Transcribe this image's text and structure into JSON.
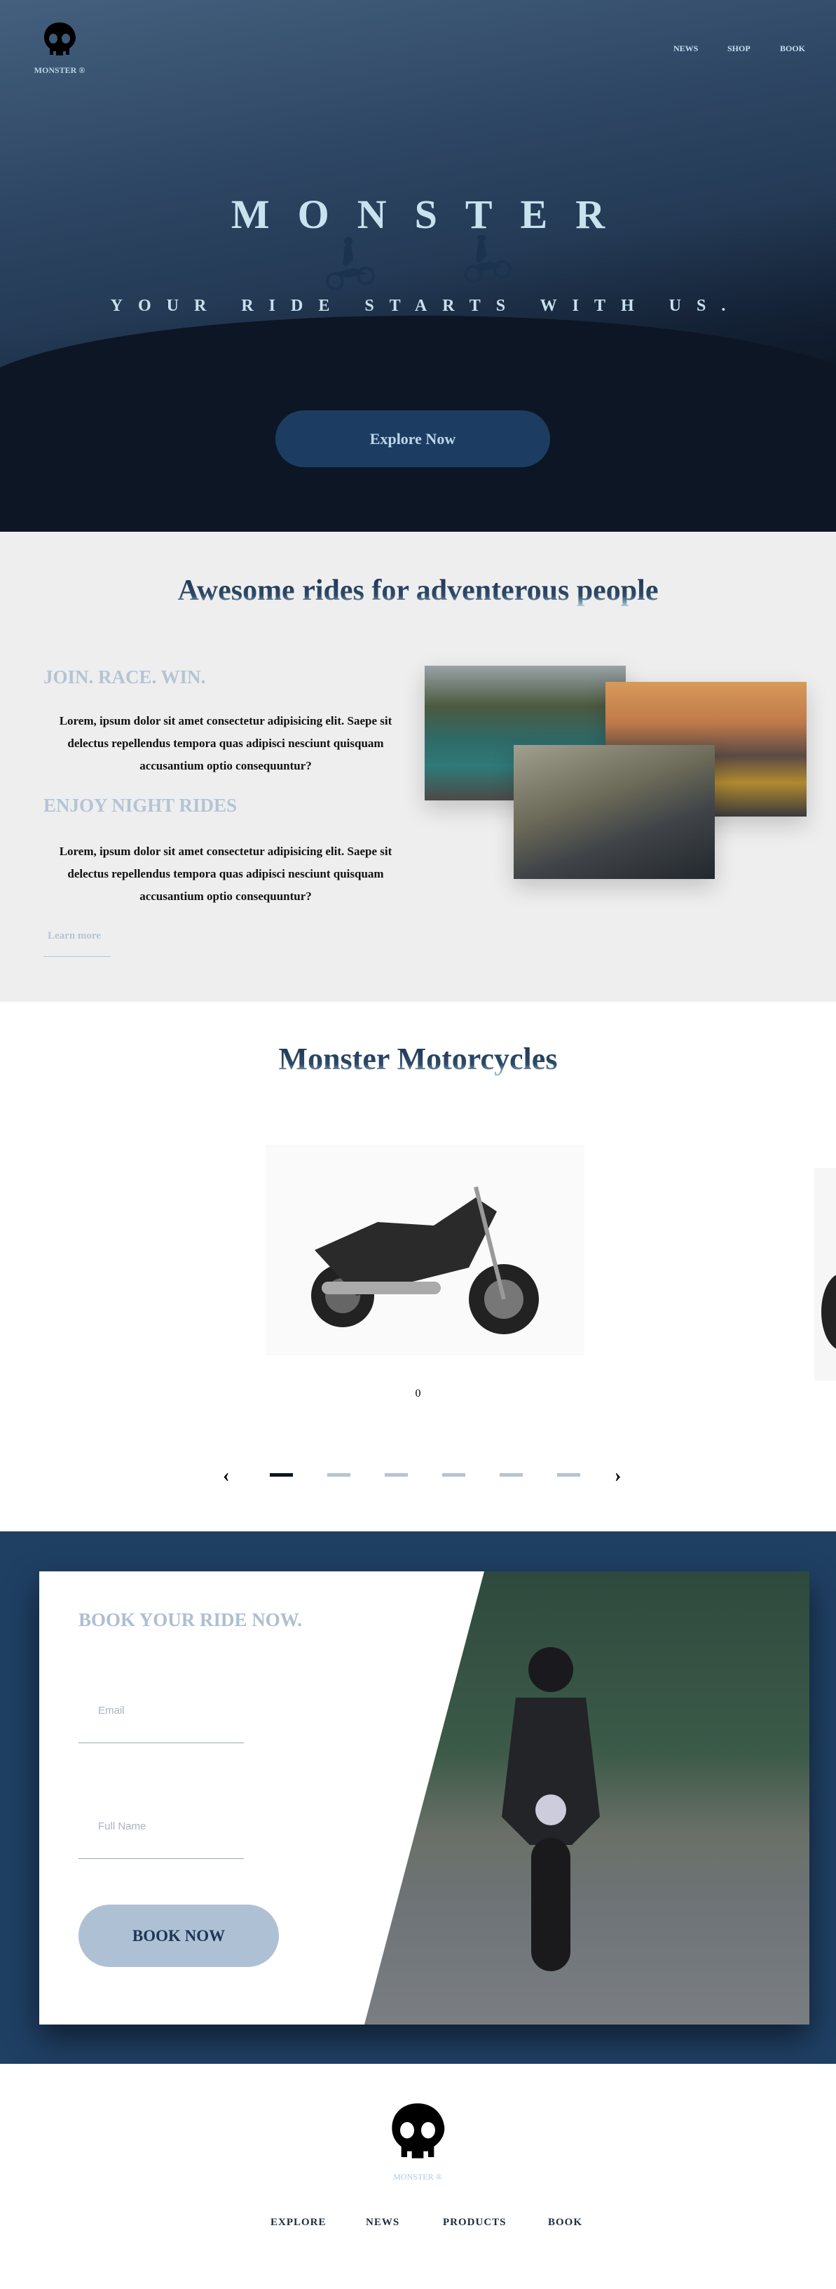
{
  "header": {
    "logo_text": "MONSTER ®",
    "nav": [
      "NEWS",
      "SHOP",
      "BOOK"
    ]
  },
  "hero": {
    "title": "MONSTER",
    "subtitle": "YOUR RIDE STARTS WITH US.",
    "cta": "Explore Now"
  },
  "about": {
    "heading": "Awesome rides for adventerous people",
    "blocks": [
      {
        "title": "JOIN. RACE. WIN.",
        "text": "Lorem, ipsum dolor sit amet consectetur adipisicing elit. Saepe sit delectus repellendus tempora quas adipisci nesciunt quisquam accusantium optio consequuntur?"
      },
      {
        "title": "ENJOY NIGHT RIDES",
        "text": "Lorem, ipsum dolor sit amet consectetur adipisicing elit. Saepe sit delectus repellendus tempora quas adipisci nesciunt quisquam accusantium optio consequuntur?"
      }
    ],
    "learn_more": "Learn more"
  },
  "products": {
    "heading": "Monster Motorcycles",
    "caption": "0",
    "slide_count": 6,
    "active_slide": 0,
    "prev_icon": "chevron-left-icon",
    "next_icon": "chevron-right-icon"
  },
  "booking": {
    "heading": "BOOK YOUR RIDE NOW.",
    "email_placeholder": "Email",
    "name_placeholder": "Full Name",
    "submit": "BOOK NOW"
  },
  "footer": {
    "logo_text": "MONSTER ®",
    "links": [
      "EXPLORE",
      "NEWS",
      "PRODUCTS",
      "BOOK"
    ]
  },
  "colors": {
    "navy": "#1f3f63",
    "accent_light": "#aec0d4",
    "section_bg": "#eeeeee"
  }
}
